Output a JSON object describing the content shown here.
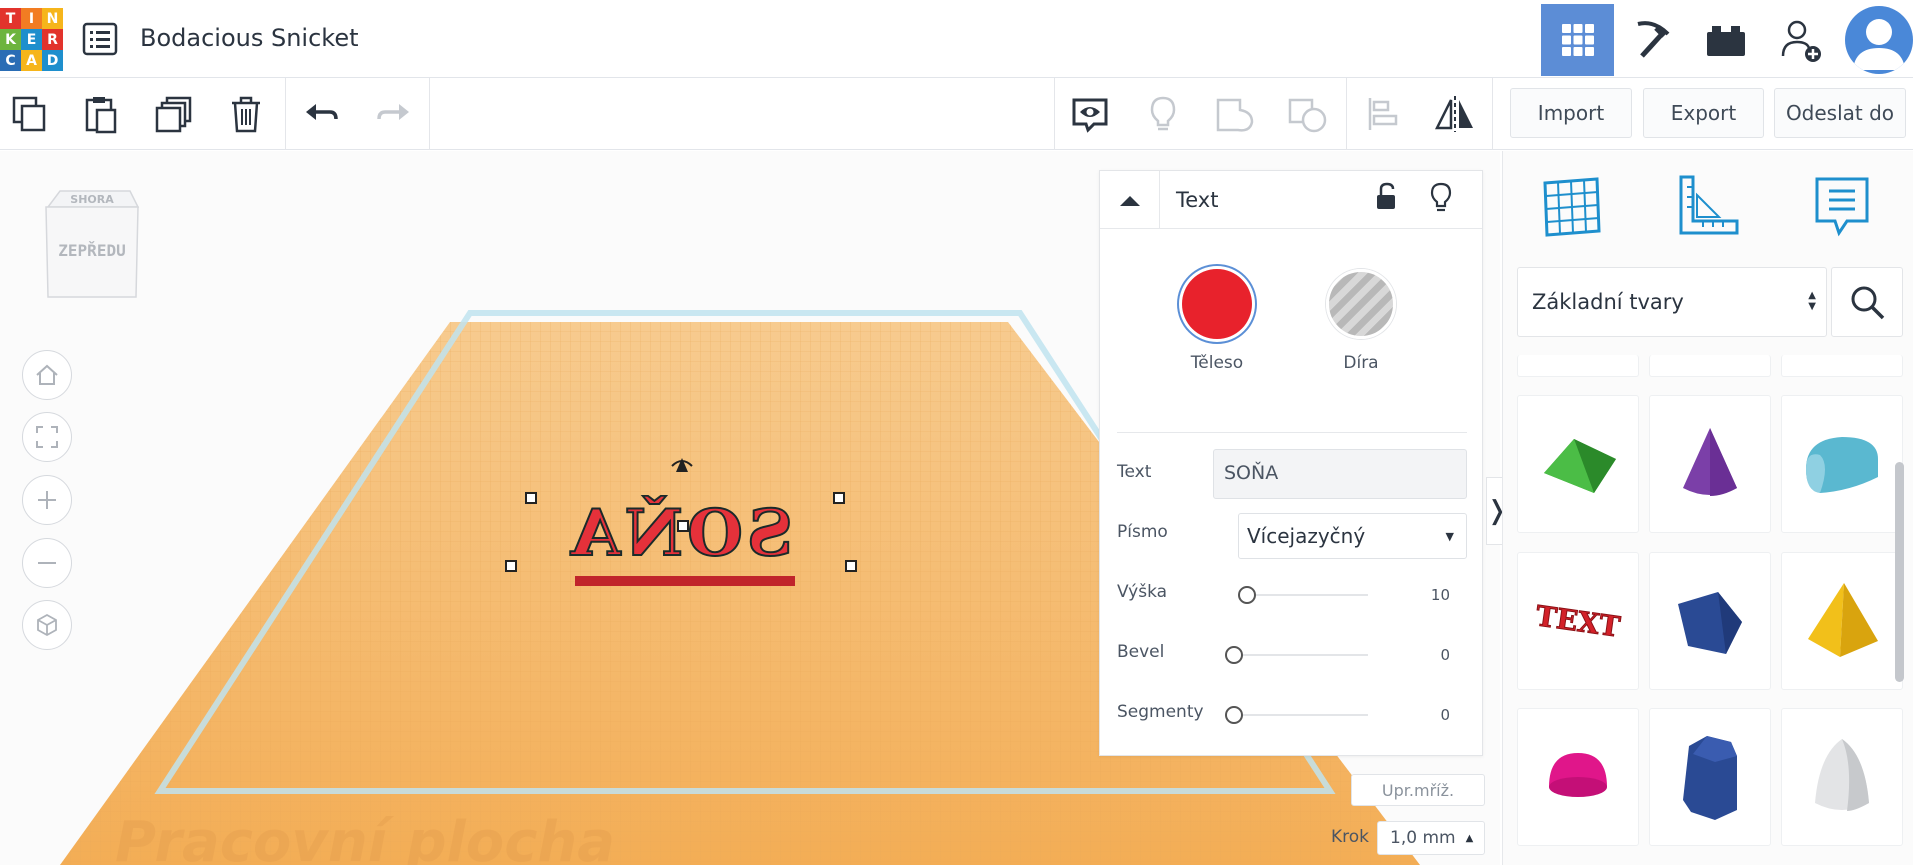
{
  "app": {
    "logo_letters": [
      "T",
      "I",
      "N",
      "K",
      "E",
      "R",
      "C",
      "A",
      "D"
    ],
    "logo_colors": [
      "#e2332c",
      "#f27c22",
      "#f6b51b",
      "#6db43e",
      "#1e8fcd",
      "#e2332c",
      "#2a6db5",
      "#f6b51b",
      "#1e8fcd"
    ],
    "project_title": "Bodacious Snicket"
  },
  "topbar": {
    "icons": [
      "menu-list-icon",
      "grid-3d-view-icon",
      "pickaxe-codeblocks-icon",
      "bricks-icon",
      "add-user-icon",
      "user-avatar-icon"
    ]
  },
  "toolbar": {
    "import_label": "Import",
    "export_label": "Export",
    "send_label": "Odeslat do"
  },
  "viewcube": {
    "top_label": "SHORA",
    "front_label": "ZEPŘEDU"
  },
  "workplane": {
    "watermark": "Pracovní plocha",
    "edit_grid_label": "Upr.mříž.",
    "snap_label": "Krok",
    "snap_value": "1,0 mm",
    "object_text": "SOŇA"
  },
  "inspector": {
    "title": "Text",
    "solid_label": "Těleso",
    "hole_label": "Díra",
    "solid_color": "#e8222c",
    "text_label": "Text",
    "text_value": "SOŇA",
    "font_label": "Písmo",
    "font_value": "Vícejazyčný",
    "height_label": "Výška",
    "height_value": "10",
    "bevel_label": "Bevel",
    "bevel_value": "0",
    "segments_label": "Segmenty",
    "segments_value": "0"
  },
  "shapes_panel": {
    "category": "Základní tvary",
    "tabs": [
      "grid-icon",
      "ruler-icon",
      "notes-icon"
    ],
    "shapes": [
      "roof",
      "cone",
      "half-cylinder",
      "text",
      "polygon",
      "pyramid",
      "hemisphere",
      "hexagonal-prism",
      "paraboloid"
    ]
  }
}
